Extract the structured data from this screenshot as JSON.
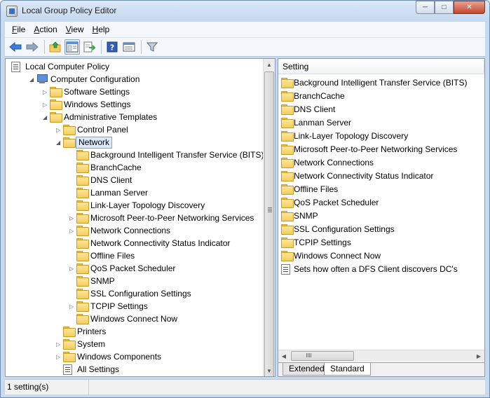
{
  "window": {
    "title": "Local Group Policy Editor"
  },
  "menu": [
    "File",
    "Action",
    "View",
    "Help"
  ],
  "menu_accel": [
    "F",
    "A",
    "V",
    "H"
  ],
  "toolbar_icons": [
    "back-icon",
    "forward-icon",
    "up-folder-icon",
    "show-hide-tree-icon",
    "export-list-icon",
    "help-icon",
    "properties-icon",
    "filter-icon"
  ],
  "tree": [
    {
      "label": "Local Computer Policy",
      "level": 0,
      "expander": "none",
      "icon": "doc"
    },
    {
      "label": "Computer Configuration",
      "level": 1,
      "expander": "open",
      "icon": "computer"
    },
    {
      "label": "Software Settings",
      "level": 2,
      "expander": "closed",
      "icon": "folder"
    },
    {
      "label": "Windows Settings",
      "level": 2,
      "expander": "closed",
      "icon": "folder"
    },
    {
      "label": "Administrative Templates",
      "level": 2,
      "expander": "open",
      "icon": "folder"
    },
    {
      "label": "Control Panel",
      "level": 3,
      "expander": "closed",
      "icon": "folder"
    },
    {
      "label": "Network",
      "level": 3,
      "expander": "open",
      "icon": "folder",
      "selected": true
    },
    {
      "label": "Background Intelligent Transfer Service (BITS)",
      "level": 4,
      "expander": "none",
      "icon": "folder"
    },
    {
      "label": "BranchCache",
      "level": 4,
      "expander": "none",
      "icon": "folder"
    },
    {
      "label": "DNS Client",
      "level": 4,
      "expander": "none",
      "icon": "folder"
    },
    {
      "label": "Lanman Server",
      "level": 4,
      "expander": "none",
      "icon": "folder"
    },
    {
      "label": "Link-Layer Topology Discovery",
      "level": 4,
      "expander": "none",
      "icon": "folder"
    },
    {
      "label": "Microsoft Peer-to-Peer Networking Services",
      "level": 4,
      "expander": "closed",
      "icon": "folder"
    },
    {
      "label": "Network Connections",
      "level": 4,
      "expander": "closed",
      "icon": "folder"
    },
    {
      "label": "Network Connectivity Status Indicator",
      "level": 4,
      "expander": "none",
      "icon": "folder"
    },
    {
      "label": "Offline Files",
      "level": 4,
      "expander": "none",
      "icon": "folder"
    },
    {
      "label": "QoS Packet Scheduler",
      "level": 4,
      "expander": "closed",
      "icon": "folder"
    },
    {
      "label": "SNMP",
      "level": 4,
      "expander": "none",
      "icon": "folder"
    },
    {
      "label": "SSL Configuration Settings",
      "level": 4,
      "expander": "none",
      "icon": "folder"
    },
    {
      "label": "TCPIP Settings",
      "level": 4,
      "expander": "closed",
      "icon": "folder"
    },
    {
      "label": "Windows Connect Now",
      "level": 4,
      "expander": "none",
      "icon": "folder"
    },
    {
      "label": "Printers",
      "level": 3,
      "expander": "none",
      "icon": "folder"
    },
    {
      "label": "System",
      "level": 3,
      "expander": "closed",
      "icon": "folder"
    },
    {
      "label": "Windows Components",
      "level": 3,
      "expander": "closed",
      "icon": "folder"
    },
    {
      "label": "All Settings",
      "level": 3,
      "expander": "none",
      "icon": "doc"
    }
  ],
  "settings_pane": {
    "column_header": "Setting",
    "items": [
      {
        "label": "Background Intelligent Transfer Service (BITS)",
        "icon": "folder"
      },
      {
        "label": "BranchCache",
        "icon": "folder"
      },
      {
        "label": "DNS Client",
        "icon": "folder"
      },
      {
        "label": "Lanman Server",
        "icon": "folder"
      },
      {
        "label": "Link-Layer Topology Discovery",
        "icon": "folder"
      },
      {
        "label": "Microsoft Peer-to-Peer Networking Services",
        "icon": "folder"
      },
      {
        "label": "Network Connections",
        "icon": "folder"
      },
      {
        "label": "Network Connectivity Status Indicator",
        "icon": "folder"
      },
      {
        "label": "Offline Files",
        "icon": "folder"
      },
      {
        "label": "QoS Packet Scheduler",
        "icon": "folder"
      },
      {
        "label": "SNMP",
        "icon": "folder"
      },
      {
        "label": "SSL Configuration Settings",
        "icon": "folder"
      },
      {
        "label": "TCPIP Settings",
        "icon": "folder"
      },
      {
        "label": "Windows Connect Now",
        "icon": "folder"
      },
      {
        "label": "Sets how often a DFS Client discovers DC's",
        "icon": "doc"
      }
    ],
    "tabs": [
      "Extended",
      "Standard"
    ],
    "active_tab": "Standard"
  },
  "status": {
    "text": "1 setting(s)"
  }
}
